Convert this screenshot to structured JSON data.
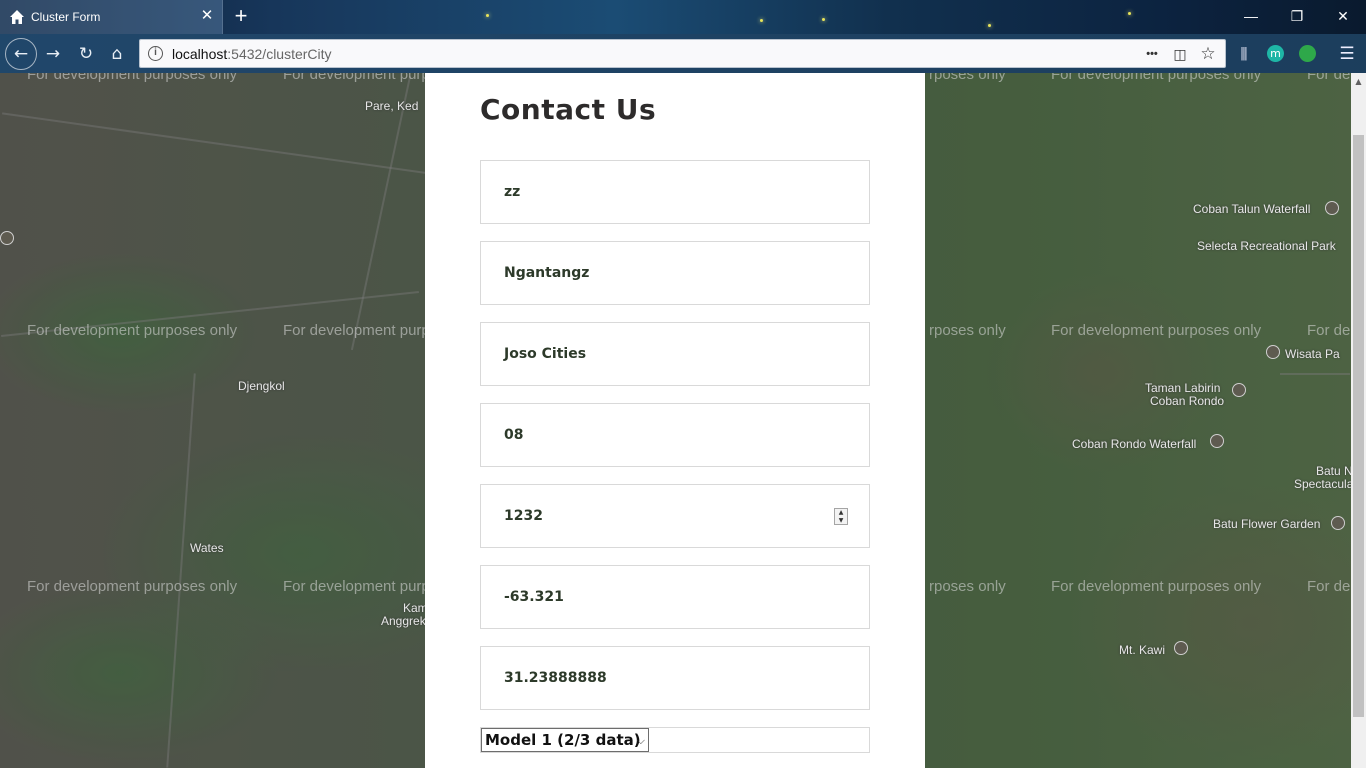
{
  "browser": {
    "tab_title": "Cluster Form",
    "tab_close": "✕",
    "new_tab": "+",
    "url_host": "localhost",
    "url_rest": ":5432/clusterCity",
    "window": {
      "minimize": "—",
      "restore": "❐",
      "close": "✕"
    },
    "icons": {
      "back": "←",
      "forward": "→",
      "reload": "↻",
      "home": "⌂",
      "page_actions": "•••",
      "pocket": "◫",
      "bookmark": "☆",
      "library": "⫼",
      "account": "m",
      "menu": "☰"
    }
  },
  "map": {
    "watermark": "For development purposes only",
    "watermark_partial": "For de",
    "watermark_left_partial": "rposes only",
    "places": [
      "Pare, Ked",
      "Djengkol",
      "Wates",
      "Kam",
      "Anggrek",
      "Coban Talun Waterfall",
      "Selecta Recreational Park",
      "Wisata Pa",
      "Taman Labirin",
      "Coban Rondo",
      "Coban Rondo Waterfall",
      "Batu N",
      "Spectacular (B",
      "Batu Flower Garden",
      "Mt. Kawi"
    ]
  },
  "form": {
    "title": "Contact Us",
    "fields": [
      {
        "value": "zz"
      },
      {
        "value": "Ngantangz"
      },
      {
        "value": "Joso Cities"
      },
      {
        "value": "08"
      },
      {
        "value": "1232"
      },
      {
        "value": "-63.321"
      },
      {
        "value": "31.23888888"
      }
    ],
    "select_value": "Model 1 (2/3 data)"
  }
}
